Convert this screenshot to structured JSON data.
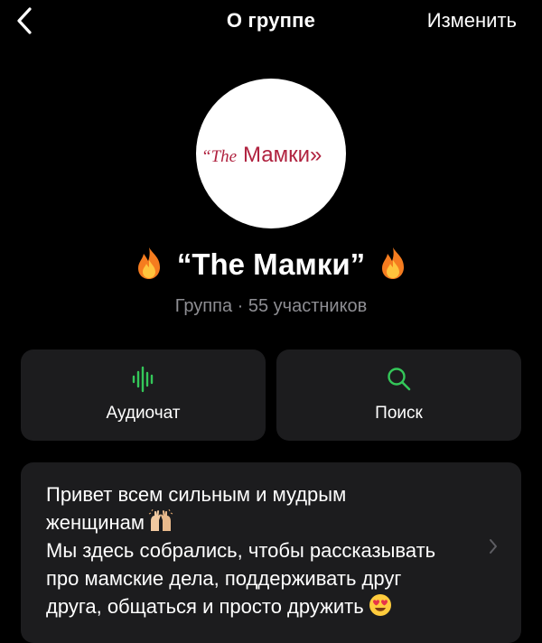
{
  "nav": {
    "title": "О группе",
    "edit_label": "Изменить"
  },
  "avatar": {
    "logo_text_prefix": "“The",
    "logo_text_main": "Мамки»",
    "logo_color": "#b0223f"
  },
  "group": {
    "name": "“The Мамки”",
    "subtitle": "Группа · 55 участников"
  },
  "actions": [
    {
      "label": "Аудиочат",
      "icon": "audio-waveform-icon"
    },
    {
      "label": "Поиск",
      "icon": "search-icon"
    }
  ],
  "description": {
    "lines": [
      "Привет всем сильным и мудрым",
      "женщинам",
      "Мы здесь собрались, чтобы рассказывать",
      "про мамские дела, поддерживать друг",
      "друга, общаться и просто дружить"
    ]
  },
  "colors": {
    "accent": "#34c759",
    "card": "#1c1c1e",
    "secondary_text": "#8e8e93"
  }
}
